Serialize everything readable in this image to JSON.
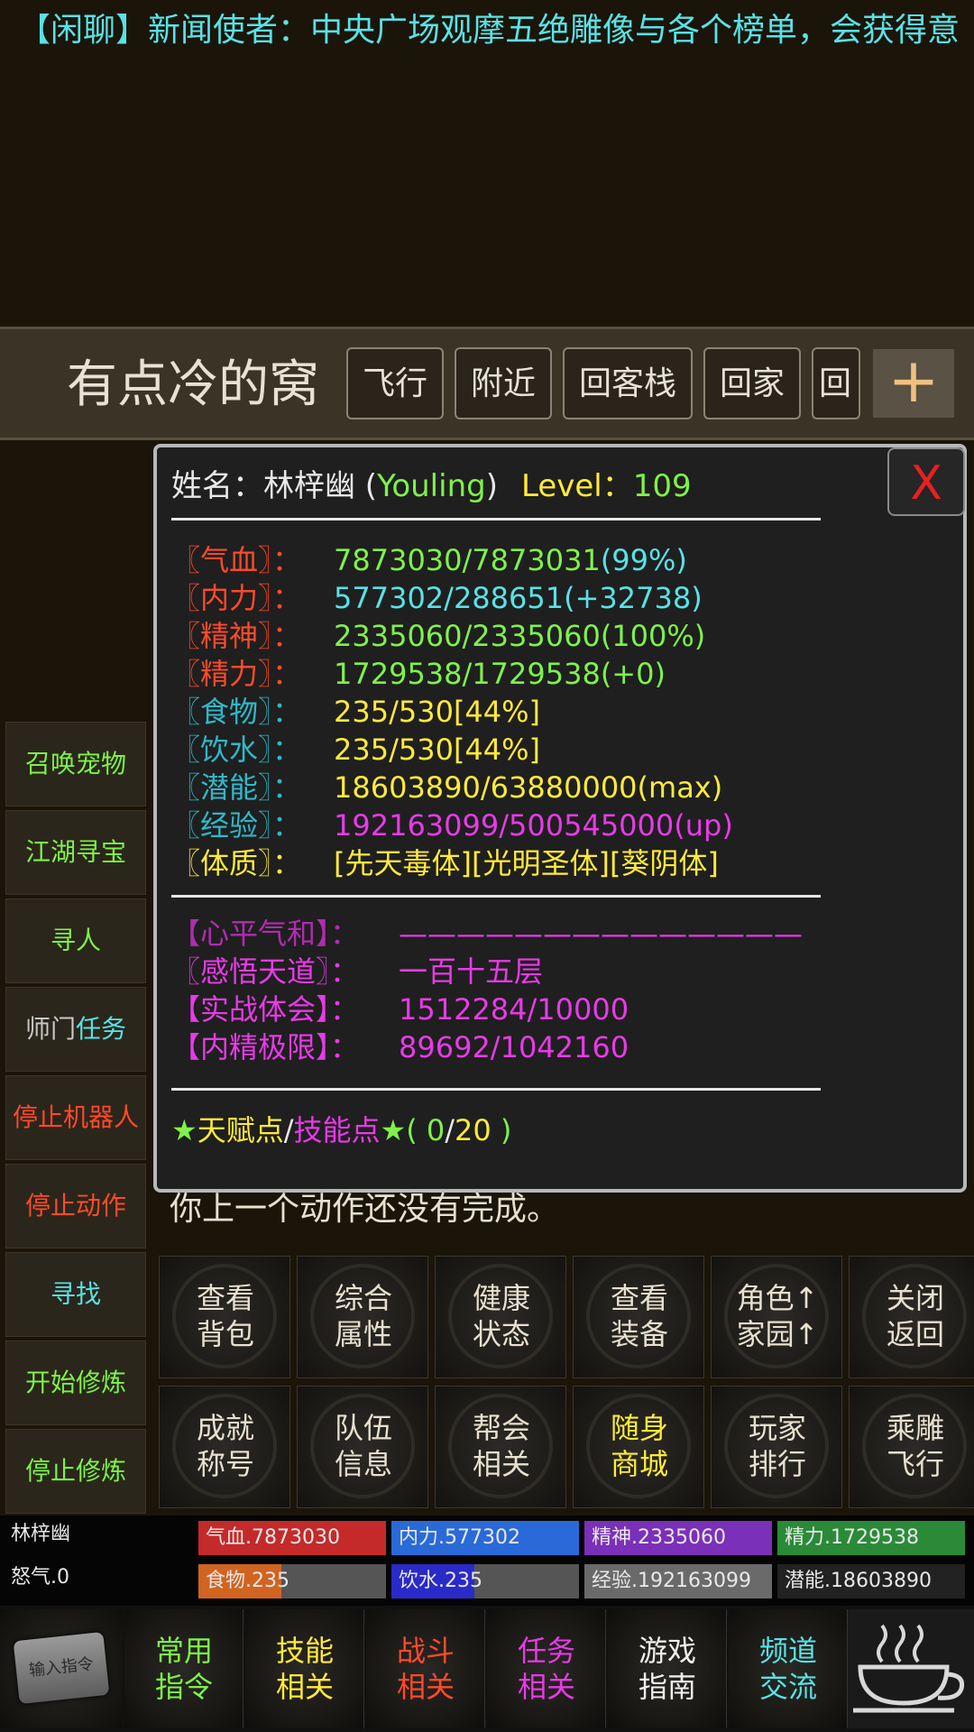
{
  "ticker": {
    "text": "【闲聊】新闻使者：中央广场观摩五绝雕像与各个榜单，会获得意"
  },
  "location": {
    "title": "有点冷的窝",
    "buttons": [
      "飞行",
      "附近",
      "回客栈",
      "回家",
      "回门"
    ],
    "plus": "+"
  },
  "sidebar": [
    {
      "label": "召唤宠物",
      "color": "#7ef24a"
    },
    {
      "label": "江湖寻宝",
      "color": "#7ef24a"
    },
    {
      "label": "寻人",
      "color": "#7ef24a"
    },
    {
      "label_a": "师门",
      "label_b": "任务",
      "color_a": "#c8c8c8",
      "color_b": "#58e2e6"
    },
    {
      "label": "停止机器人",
      "color": "#ff4a2a"
    },
    {
      "label": "停止动作",
      "color": "#ff4a2a"
    },
    {
      "label": "寻找",
      "color": "#58e2e6"
    },
    {
      "label": "开始修炼",
      "color": "#7ef24a"
    },
    {
      "label": "停止修炼",
      "color": "#7ef24a"
    }
  ],
  "panel": {
    "close": "X",
    "name_label": "姓名：",
    "name": "林梓幽",
    "alias_open": " (",
    "alias": "Youling",
    "alias_close": ")",
    "level_label": "Level：",
    "level": "109",
    "separator": "————————————————————————————",
    "short_separator": "——————————————",
    "stats": [
      {
        "label": "〖气血〗：",
        "value": "7873030/7873031",
        "suffix": "(99%)",
        "lcolor": "#ff4a2a",
        "vcolor": "#7ef24a",
        "scolor": "#58e2e6"
      },
      {
        "label": "〖内力〗：",
        "value": "577302/288651",
        "suffix": "(+32738)",
        "lcolor": "#ff4a2a",
        "vcolor": "#58e2e6",
        "scolor": "#58e2e6"
      },
      {
        "label": "〖精神〗：",
        "value": "2335060/2335060",
        "suffix": "(100%)",
        "lcolor": "#ff4a2a",
        "vcolor": "#7ef24a",
        "scolor": "#7ef24a"
      },
      {
        "label": "〖精力〗：",
        "value": "1729538/1729538",
        "suffix": "(+0)",
        "lcolor": "#ff4a2a",
        "vcolor": "#7ef24a",
        "scolor": "#7ef24a"
      },
      {
        "label": "〖食物〗：",
        "value": "235/530",
        "suffix": "[44%]",
        "lcolor": "#2fb8c8",
        "vcolor": "#ffea3a",
        "scolor": "#ffea3a"
      },
      {
        "label": "〖饮水〗：",
        "value": "235/530",
        "suffix": "[44%]",
        "lcolor": "#2fb8c8",
        "vcolor": "#ffea3a",
        "scolor": "#ffea3a"
      },
      {
        "label": "〖潜能〗：",
        "value": "18603890/63880000",
        "suffix": "(max)",
        "lcolor": "#2fb8c8",
        "vcolor": "#ffea3a",
        "scolor": "#ffea3a"
      },
      {
        "label": "〖经验〗：",
        "value": "192163099/500545000",
        "suffix": "(up)",
        "lcolor": "#2fb8c8",
        "vcolor": "#e83ae8",
        "scolor": "#e83ae8"
      },
      {
        "label": "〖体质〗：",
        "value": "[先天毒体][光明圣体][葵阴体]",
        "suffix": "",
        "lcolor": "#ffea3a",
        "vcolor": "#ffea3a",
        "scolor": "#ffea3a"
      }
    ],
    "extra": [
      {
        "label": "【心平气和】：",
        "value": "——————————————",
        "lcolor": "#b02cb0",
        "vcolor": "#e83ae8"
      },
      {
        "label": "〖感悟天道〗：",
        "value": "一百十五层",
        "lcolor": "#e83ae8",
        "vcolor": "#e83ae8"
      },
      {
        "label": "【实战体会】：",
        "value": "1512284/10000",
        "lcolor": "#e83ae8",
        "vcolor": "#e83ae8"
      },
      {
        "label": "【内精极限】：",
        "value": "89692/1042160",
        "lcolor": "#e83ae8",
        "vcolor": "#e83ae8"
      }
    ],
    "talent": {
      "star1": "★",
      "talent_label": "天赋点",
      "slash": "/",
      "skill_label": "技能点",
      "star2": "★",
      "open": "( ",
      "used": "0",
      "slash2": "/",
      "total": "20",
      "close": " )"
    }
  },
  "message": "你上一个动作还没有完成。",
  "grid": [
    [
      {
        "t1": "查看",
        "t2": "背包",
        "color": "#e8e0cf"
      },
      {
        "t1": "综合",
        "t2": "属性",
        "color": "#e8e0cf"
      },
      {
        "t1": "健康",
        "t2": "状态",
        "color": "#e8e0cf"
      },
      {
        "t1": "查看",
        "t2": "装备",
        "color": "#e8e0cf"
      },
      {
        "t1": "角色↑",
        "t2": "家园↑",
        "color": "#e8e0cf"
      },
      {
        "t1": "关闭",
        "t2": "返回",
        "color": "#e8e0cf"
      }
    ],
    [
      {
        "t1": "成就",
        "t2": "称号",
        "color": "#e8e0cf"
      },
      {
        "t1": "队伍",
        "t2": "信息",
        "color": "#e8e0cf"
      },
      {
        "t1": "帮会",
        "t2": "相关",
        "color": "#e8e0cf"
      },
      {
        "t1": "随身",
        "t2": "商城",
        "color": "#ffea3a"
      },
      {
        "t1": "玩家",
        "t2": "排行",
        "color": "#e8e0cf"
      },
      {
        "t1": "乘雕",
        "t2": "飞行",
        "color": "#e8e0cf"
      }
    ]
  ],
  "statusbar": {
    "name": "林梓幽",
    "rage": "怒气.0",
    "bars": [
      {
        "text": "气血.7873030",
        "color": "#c42a2a",
        "fill": 1.0
      },
      {
        "text": "内力.577302",
        "color": "#2a6ad8",
        "fill": 1.0
      },
      {
        "text": "精神.2335060",
        "color": "#7a30b8",
        "fill": 1.0
      },
      {
        "text": "精力.1729538",
        "color": "#2a8a38",
        "fill": 1.0
      },
      {
        "text": "食物.235",
        "color": "#d06420",
        "fill": 0.44
      },
      {
        "text": "饮水.235",
        "color": "#2a2ac8",
        "fill": 0.44
      },
      {
        "text": "经验.192163099",
        "color": "#6a6a6a",
        "fill": 1.0
      },
      {
        "text": "潜能.18603890",
        "color": "#222222",
        "fill": 1.0
      }
    ]
  },
  "bottomnav": {
    "input_label": "输入指令",
    "items": [
      {
        "t1": "常用",
        "t2": "指令",
        "color": "#7ef24a"
      },
      {
        "t1": "技能",
        "t2": "相关",
        "color": "#ffea3a"
      },
      {
        "t1": "战斗",
        "t2": "相关",
        "color": "#ff4a2a"
      },
      {
        "t1": "任务",
        "t2": "相关",
        "color": "#e83ae8"
      },
      {
        "t1": "游戏",
        "t2": "指南",
        "color": "#f0f0f0"
      },
      {
        "t1": "频道",
        "t2": "交流",
        "color": "#58e2e6"
      }
    ],
    "tea_icon": "teacup-icon"
  }
}
